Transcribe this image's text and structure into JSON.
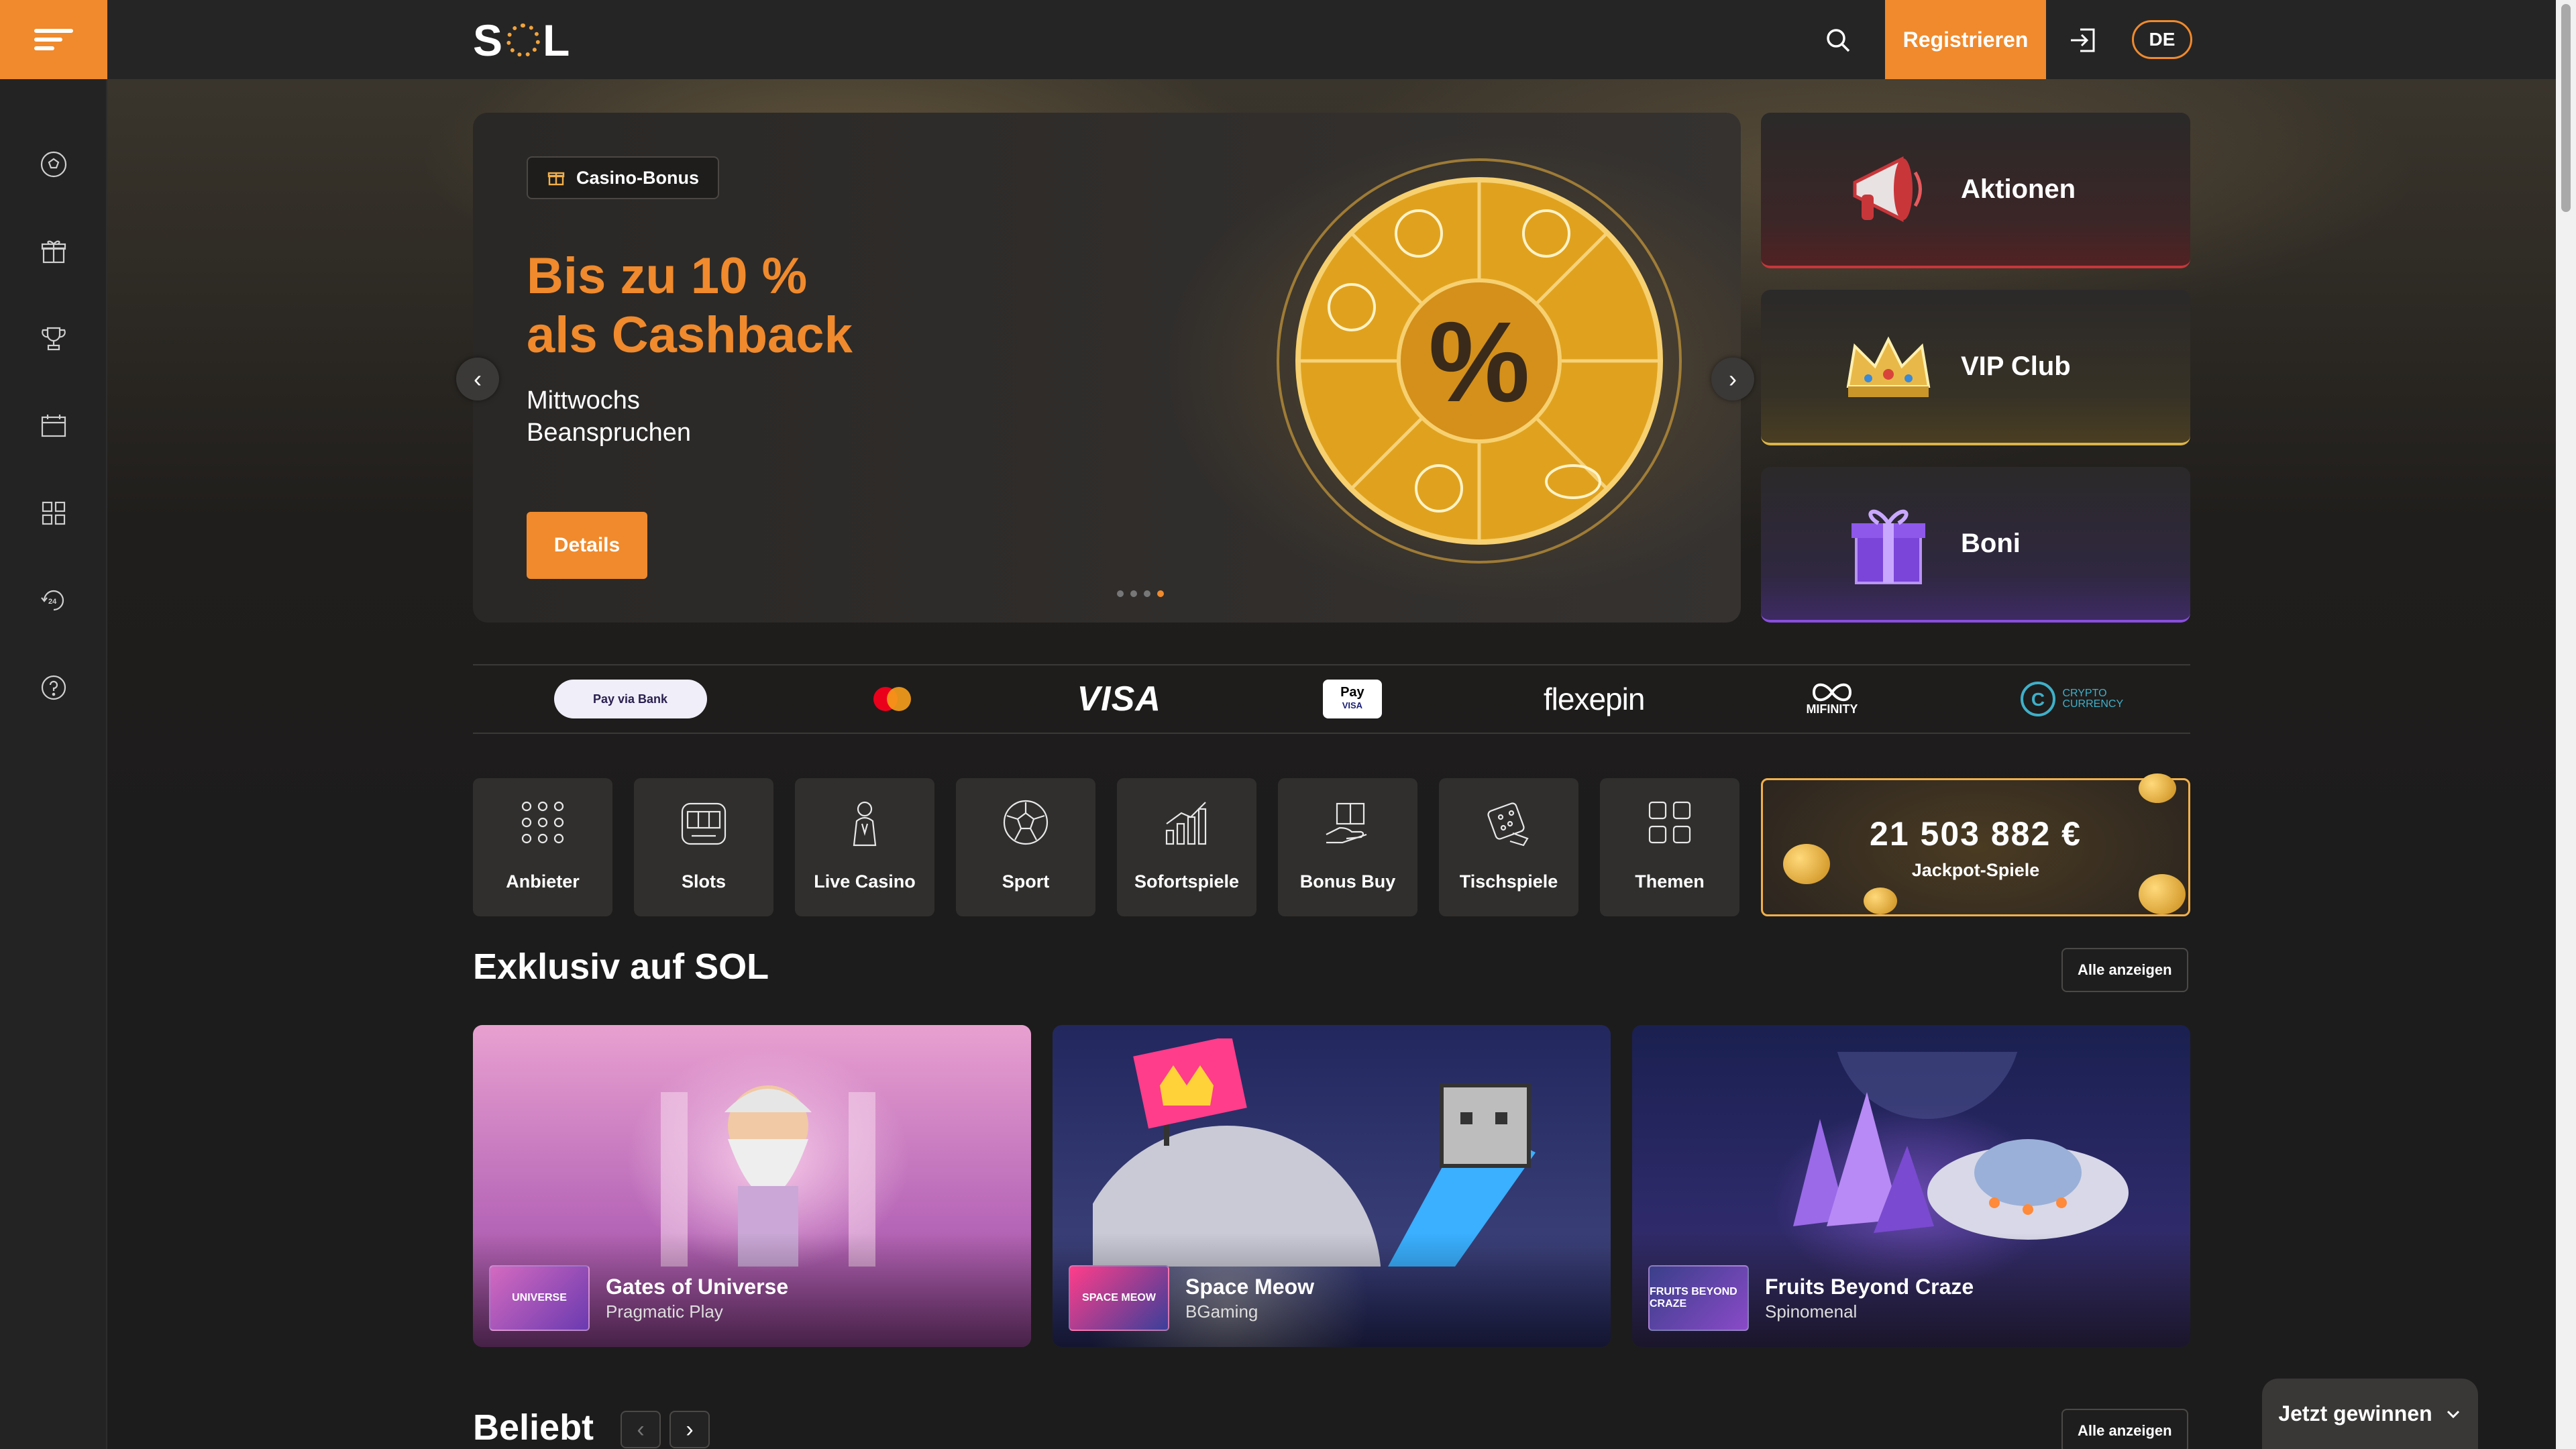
{
  "header": {
    "logo": "S",
    "logo_end": "L",
    "register_label": "Registrieren",
    "language": "DE"
  },
  "sidebar": {
    "icons": [
      "soccer-ball-icon",
      "gift-icon",
      "trophy-icon",
      "calendar-icon",
      "grid-icon",
      "support-24-icon",
      "help-icon"
    ]
  },
  "hero": {
    "badge": "Casino-Bonus",
    "title_line1": "Bis zu 10 %",
    "title_line2": "als Cashback",
    "subtitle_line1": "Mittwochs",
    "subtitle_line2": "Beanspruchen",
    "cta": "Details",
    "slide_count": 4,
    "active_slide": 4
  },
  "promos": [
    {
      "label": "Aktionen",
      "icon": "megaphone-icon"
    },
    {
      "label": "VIP Club",
      "icon": "crown-icon"
    },
    {
      "label": "Boni",
      "icon": "gift-box-icon"
    }
  ],
  "payments": {
    "bank": "Pay via Bank",
    "visa": "VISA",
    "apple_top": "Pay",
    "apple_bottom": "VISA",
    "flexepin": "flexepin",
    "mifinity": "MIFINITY",
    "crypto": "CRYPTO CURRENCY"
  },
  "categories": [
    {
      "label": "Anbieter",
      "icon": "providers-icon"
    },
    {
      "label": "Slots",
      "icon": "slot-machine-icon"
    },
    {
      "label": "Live Casino",
      "icon": "dealer-icon"
    },
    {
      "label": "Sport",
      "icon": "soccer-ball-icon"
    },
    {
      "label": "Sofortspiele",
      "icon": "chart-icon"
    },
    {
      "label": "Bonus Buy",
      "icon": "bonus-buy-icon"
    },
    {
      "label": "Tischspiele",
      "icon": "dice-icon"
    },
    {
      "label": "Themen",
      "icon": "themes-icon"
    }
  ],
  "jackpot": {
    "amount": "21 503 882 €",
    "label": "Jackpot-Spiele"
  },
  "exclusive": {
    "title": "Exklusiv auf SOL",
    "show_all": "Alle anzeigen",
    "games": [
      {
        "name": "Gates of Universe",
        "provider": "Pragmatic Play",
        "thumb": "UNIVERSE"
      },
      {
        "name": "Space Meow",
        "provider": "BGaming",
        "thumb": "SPACE MEOW"
      },
      {
        "name": "Fruits Beyond Craze",
        "provider": "Spinomenal",
        "thumb": "FRUITS BEYOND CRAZE"
      }
    ]
  },
  "popular": {
    "title": "Beliebt",
    "show_all": "Alle anzeigen"
  },
  "floating": {
    "win_label": "Jetzt gewinnen"
  },
  "colors": {
    "accent": "#f08a2c",
    "background": "#1d1c1c",
    "sidebar": "#242323"
  }
}
